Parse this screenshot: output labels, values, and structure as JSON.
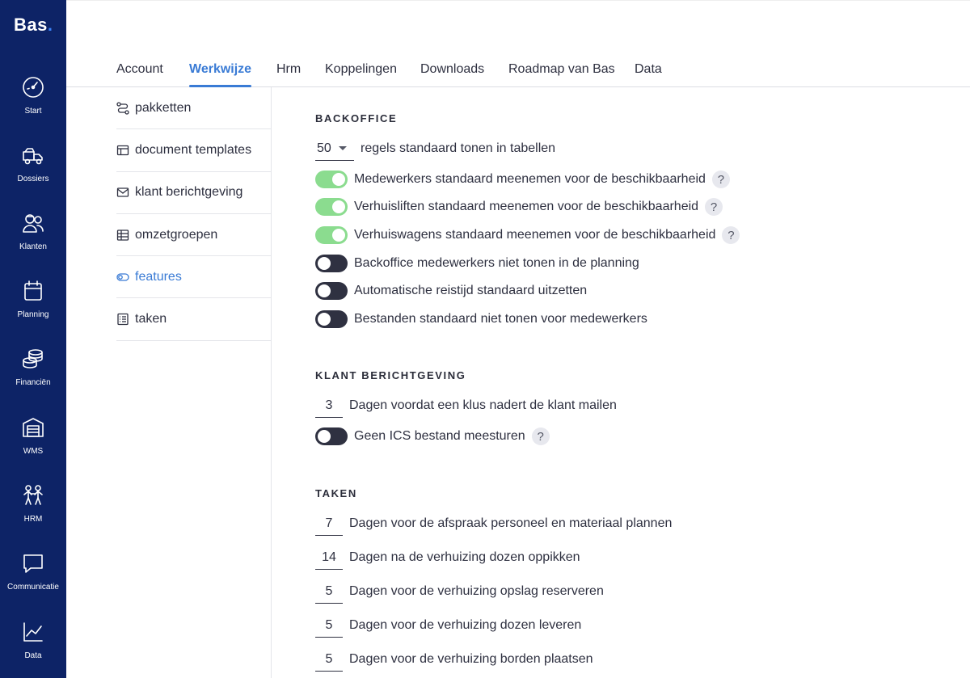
{
  "app": {
    "logo": "Bas",
    "logo_dot": "."
  },
  "sidebar": {
    "items": [
      {
        "label": "Start",
        "icon": "speedometer-icon"
      },
      {
        "label": "Dossiers",
        "icon": "moving-truck-icon"
      },
      {
        "label": "Klanten",
        "icon": "customers-icon"
      },
      {
        "label": "Planning",
        "icon": "calendar-icon"
      },
      {
        "label": "Financiën",
        "icon": "coins-icon"
      },
      {
        "label": "WMS",
        "icon": "warehouse-icon"
      },
      {
        "label": "HRM",
        "icon": "people-icon"
      },
      {
        "label": "Communicatie",
        "icon": "chat-icon"
      },
      {
        "label": "Data",
        "icon": "line-chart-icon"
      }
    ]
  },
  "tabs": [
    "Account",
    "Werkwijze",
    "Hrm",
    "Koppelingen",
    "Downloads",
    "Roadmap van Bas",
    "Data"
  ],
  "active_tab": "Werkwijze",
  "submenu": {
    "items": [
      {
        "label": "pakketten",
        "icon": "route-icon"
      },
      {
        "label": "document templates",
        "icon": "layout-icon"
      },
      {
        "label": "klant berichtgeving",
        "icon": "envelope-icon"
      },
      {
        "label": "omzetgroepen",
        "icon": "table-icon"
      },
      {
        "label": "features",
        "icon": "toggle-icon"
      },
      {
        "label": "taken",
        "icon": "checklist-icon"
      }
    ],
    "active": "features"
  },
  "backoffice": {
    "title": "BACKOFFICE",
    "rows_select": {
      "value": "50",
      "label": "regels standaard tonen in tabellen"
    },
    "toggles": [
      {
        "label": "Medewerkers standaard meenemen voor de beschikbaarheid",
        "on": true,
        "help": "?"
      },
      {
        "label": "Verhuisliften standaard meenemen voor de beschikbaarheid",
        "on": true,
        "help": "?"
      },
      {
        "label": "Verhuiswagens standaard meenemen voor de beschikbaarheid",
        "on": true,
        "help": "?"
      },
      {
        "label": "Backoffice medewerkers niet tonen in de planning",
        "on": false
      },
      {
        "label": "Automatische reistijd standaard uitzetten",
        "on": false
      },
      {
        "label": "Bestanden standaard niet tonen voor medewerkers",
        "on": false
      }
    ]
  },
  "klant": {
    "title": "KLANT BERICHTGEVING",
    "days": {
      "value": "3",
      "label": "Dagen voordat een klus nadert de klant mailen"
    },
    "toggle": {
      "label": "Geen ICS bestand meesturen",
      "on": false,
      "help": "?"
    }
  },
  "taken": {
    "title": "TAKEN",
    "rows": [
      {
        "value": "7",
        "label": "Dagen voor de afspraak personeel en materiaal plannen"
      },
      {
        "value": "14",
        "label": "Dagen na de verhuizing dozen oppikken"
      },
      {
        "value": "5",
        "label": "Dagen voor de verhuizing opslag reserveren"
      },
      {
        "value": "5",
        "label": "Dagen voor de verhuizing dozen leveren"
      },
      {
        "value": "5",
        "label": "Dagen voor de verhuizing borden plaatsen"
      }
    ]
  },
  "colors": {
    "sidebar": "#0d2366",
    "accent": "#3a7bd5",
    "toggle_on": "#8bdc8f",
    "toggle_off": "#2f3141"
  }
}
